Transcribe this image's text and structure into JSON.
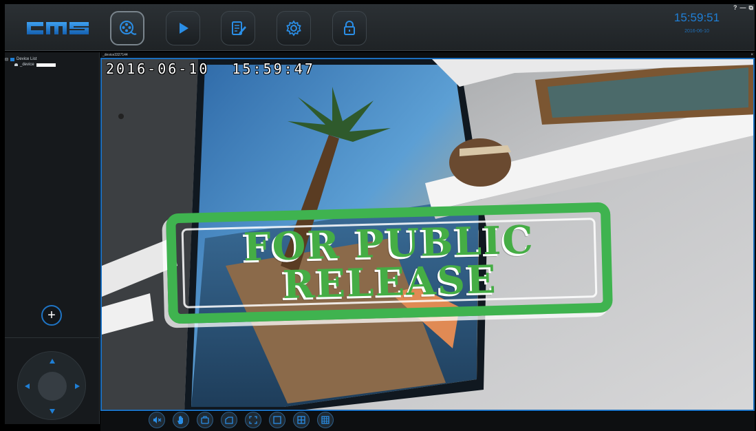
{
  "app": {
    "logo_text": "cms"
  },
  "toolbar": {
    "buttons": [
      {
        "name": "live-view",
        "icon": "film-reel-icon",
        "active": true
      },
      {
        "name": "playback",
        "icon": "play-icon",
        "active": false
      },
      {
        "name": "log",
        "icon": "edit-document-icon",
        "active": false
      },
      {
        "name": "settings",
        "icon": "gear-icon",
        "active": false
      },
      {
        "name": "lock",
        "icon": "lock-icon",
        "active": false
      }
    ],
    "clock": "15:59:51",
    "date": "2016-06-10"
  },
  "window_controls": {
    "help": "?",
    "minimize": "—",
    "restore": "⧉"
  },
  "device_tree": {
    "root_label": "Device List",
    "root_toggle": "⊟",
    "child_label": "_device"
  },
  "video": {
    "title": "_device3327144",
    "close": "×",
    "osd_timestamp": "2016-06-10  15:59:47"
  },
  "stamp": {
    "line1": "FOR PUBLIC",
    "line2": "RELEASE"
  },
  "left_panel": {
    "add_label": "+"
  },
  "bottom_toolbar": {
    "buttons": [
      "mute-icon",
      "hand-icon",
      "snapshot-icon",
      "record-icon",
      "fullscreen-icon",
      "layout-1-icon",
      "layout-4-icon",
      "layout-9-icon"
    ]
  },
  "colors": {
    "accent": "#1f7fd6",
    "stamp_green": "#3fb34f"
  }
}
